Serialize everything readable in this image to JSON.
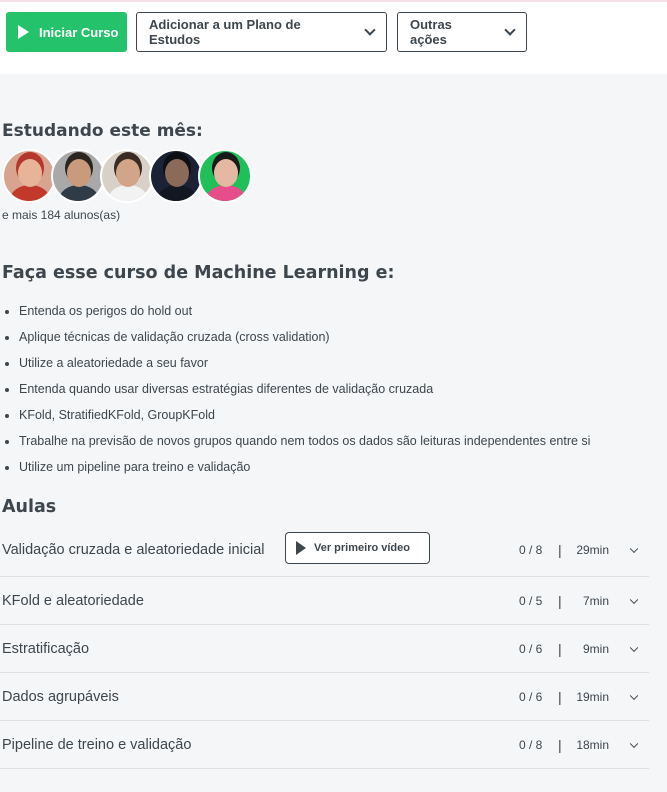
{
  "toolbar": {
    "start_label": "Iniciar Curso",
    "plan_label": "Adicionar a um Plano de Estudos",
    "actions_label": "Outras ações"
  },
  "studying": {
    "title": "Estudando este mês:",
    "more_text": "e mais 184 alunos(as)",
    "avatars": [
      {
        "bg": "#d8a48f",
        "skin": "#e7b49a",
        "shirt": "#c0392b",
        "hair": "#b5362a"
      },
      {
        "bg": "#a9a9a9",
        "skin": "#c99a7c",
        "shirt": "#2f3b47",
        "hair": "#2b2522"
      },
      {
        "bg": "#d9d1c7",
        "skin": "#d2a588",
        "shirt": "#f2f2f2",
        "hair": "#3a2c24"
      },
      {
        "bg": "#1b2235",
        "skin": "#8a6b5a",
        "shirt": "#121722",
        "hair": "#0d0f14"
      },
      {
        "bg": "#1fbf5a",
        "skin": "#e5b8a3",
        "shirt": "#e74c8b",
        "hair": "#1a1a1a"
      }
    ]
  },
  "course": {
    "title": "Faça esse curso de Machine Learning e:",
    "goals": [
      "Entenda os perigos do hold out",
      "Aplique técnicas de validação cruzada (cross validation)",
      "Utilize a aleatoriedade a seu favor",
      "Entenda quando usar diversas estratégias diferentes de validação cruzada",
      "KFold, StratifiedKFold, GroupKFold",
      "Trabalhe na previsão de novos grupos quando nem todos os dados são leituras independentes entre si",
      "Utilize um pipeline para treino e validação"
    ]
  },
  "lessons": {
    "title": "Aulas",
    "first_video_label": "Ver primeiro vídeo",
    "separator": "|",
    "items": [
      {
        "title": "Validação cruzada e aleatoriedade inicial",
        "progress": "0 / 8",
        "duration": "29min"
      },
      {
        "title": "KFold e aleatoriedade",
        "progress": "0 / 5",
        "duration": "7min"
      },
      {
        "title": "Estratificação",
        "progress": "0 / 6",
        "duration": "9min"
      },
      {
        "title": "Dados agrupáveis",
        "progress": "0 / 6",
        "duration": "19min"
      },
      {
        "title": "Pipeline de treino e validação",
        "progress": "0 / 8",
        "duration": "18min"
      }
    ]
  },
  "colors": {
    "accent": "#24c26a",
    "text": "#3d464d",
    "background": "#f4f6f8"
  },
  "icons": {
    "play": "play-icon",
    "chevron": "chevron-down-icon"
  }
}
